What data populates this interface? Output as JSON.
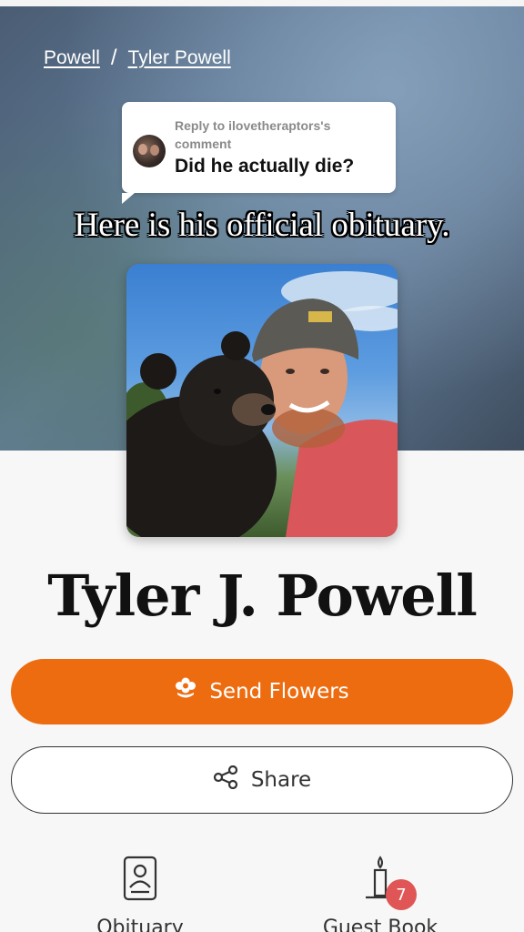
{
  "breadcrumb": {
    "items": [
      "Powell",
      "Tyler Powell"
    ],
    "separator": "/"
  },
  "reply": {
    "meta": "Reply to ilovetheraptors's comment",
    "text": "Did he actually die?"
  },
  "caption": "Here is his official obituary.",
  "profile": {
    "name": "Tyler J. Powell"
  },
  "actions": {
    "send_flowers": "Send Flowers",
    "share": "Share"
  },
  "nav": {
    "obituary": "Obituary",
    "guest_book": "Guest Book",
    "guest_book_badge": "7"
  },
  "colors": {
    "accent": "#ee6c10",
    "badge": "#e05656"
  }
}
